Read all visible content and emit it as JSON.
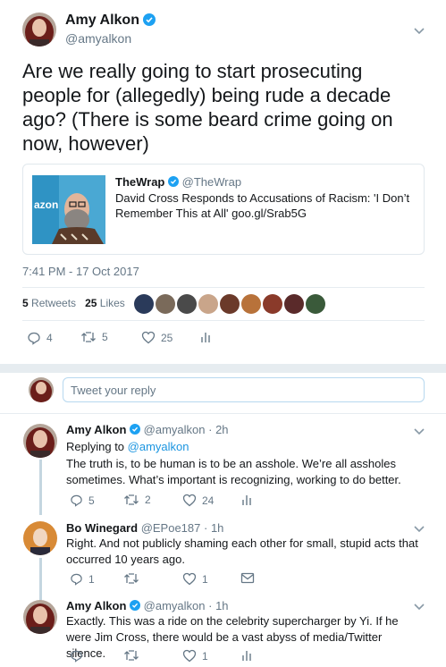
{
  "main_tweet": {
    "author_name": "Amy Alkon",
    "author_handle": "@amyalkon",
    "text": "Are we really going to start prosecuting people for (allegedly) being rude a decade ago? (There is some beard crime going on now, however)",
    "quoted": {
      "name": "TheWrap",
      "handle": "@TheWrap",
      "text": "David Cross Responds to Accusations of Racism: 'I Don’t Remember This at All' goo.gl/Srab5G",
      "image_text": "azon"
    },
    "timestamp": "7:41 PM - 17 Oct 2017",
    "retweets_count": "5",
    "retweets_label": "Retweets",
    "likes_count": "25",
    "likes_label": "Likes",
    "actions": {
      "replies": "4",
      "retweets": "5",
      "likes": "25"
    }
  },
  "reply_box": {
    "placeholder": "Tweet your reply"
  },
  "replies": [
    {
      "name": "Amy Alkon",
      "handle": "@amyalkon",
      "time": "· 2h",
      "replying_label": "Replying to",
      "replying_to": "@amyalkon",
      "text": "The truth is, to be human is to be an asshole. We’re all assholes sometimes. What’s important is recognizing, working to do better.",
      "replies": "5",
      "retweets": "2",
      "likes": "24"
    },
    {
      "name": "Bo Winegard",
      "handle": "@EPoe187",
      "time": "· 1h",
      "text": "Right. And not publicly shaming each other for small, stupid acts that occurred 10 years ago.",
      "replies": "1",
      "retweets": "",
      "likes": "1"
    },
    {
      "name": "Amy Alkon",
      "handle": "@amyalkon",
      "time": "· 1h",
      "text": "Exactly. This was a ride on the celebrity supercharger by Yi. If he were Jim Cross, there would be a vast abyss of media/Twitter silence.",
      "replies": "",
      "retweets": "",
      "likes": "1"
    }
  ],
  "colors": {
    "accent": "#1da1f2",
    "muted": "#657786",
    "divider": "#e6ecf0"
  }
}
